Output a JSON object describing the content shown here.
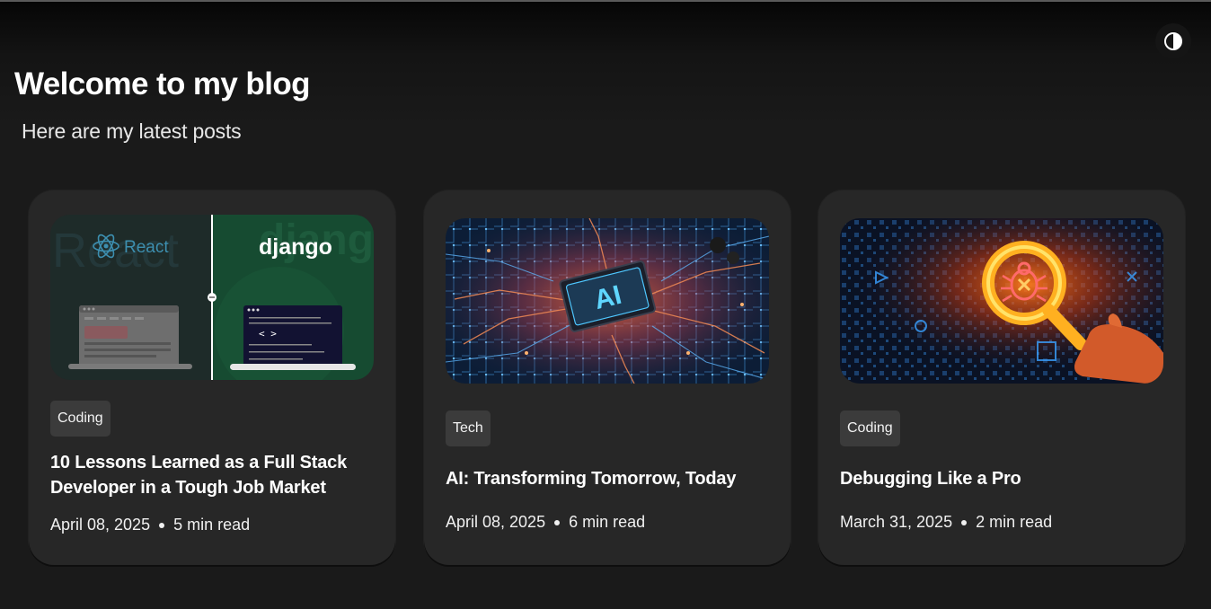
{
  "header": {
    "title": "Welcome to my blog",
    "subtitle": "Here are my latest posts",
    "theme_toggle_icon": "contrast-half-circle-icon"
  },
  "posts": [
    {
      "category": "Coding",
      "title": "10 Lessons Learned as a Full Stack Developer in a Tough Job Market",
      "date": "April 08, 2025",
      "read_time": "5 min read",
      "image": {
        "left_logo": "React",
        "left_watermark": "React",
        "right_logo": "django",
        "right_watermark": "django",
        "code_glyph": "< >"
      }
    },
    {
      "category": "Tech",
      "title": "AI: Transforming Tomorrow, Today",
      "date": "April 08, 2025",
      "read_time": "6 min read",
      "image": {
        "chip_label": "AI"
      }
    },
    {
      "category": "Coding",
      "title": "Debugging Like a Pro",
      "date": "March 31, 2025",
      "read_time": "2 min read",
      "image": {
        "subject": "bug-magnifier-icon"
      }
    }
  ],
  "colors": {
    "background": "#1a1a1a",
    "card": "#272727",
    "badge": "#3b3b3b",
    "text": "#ffffff"
  }
}
